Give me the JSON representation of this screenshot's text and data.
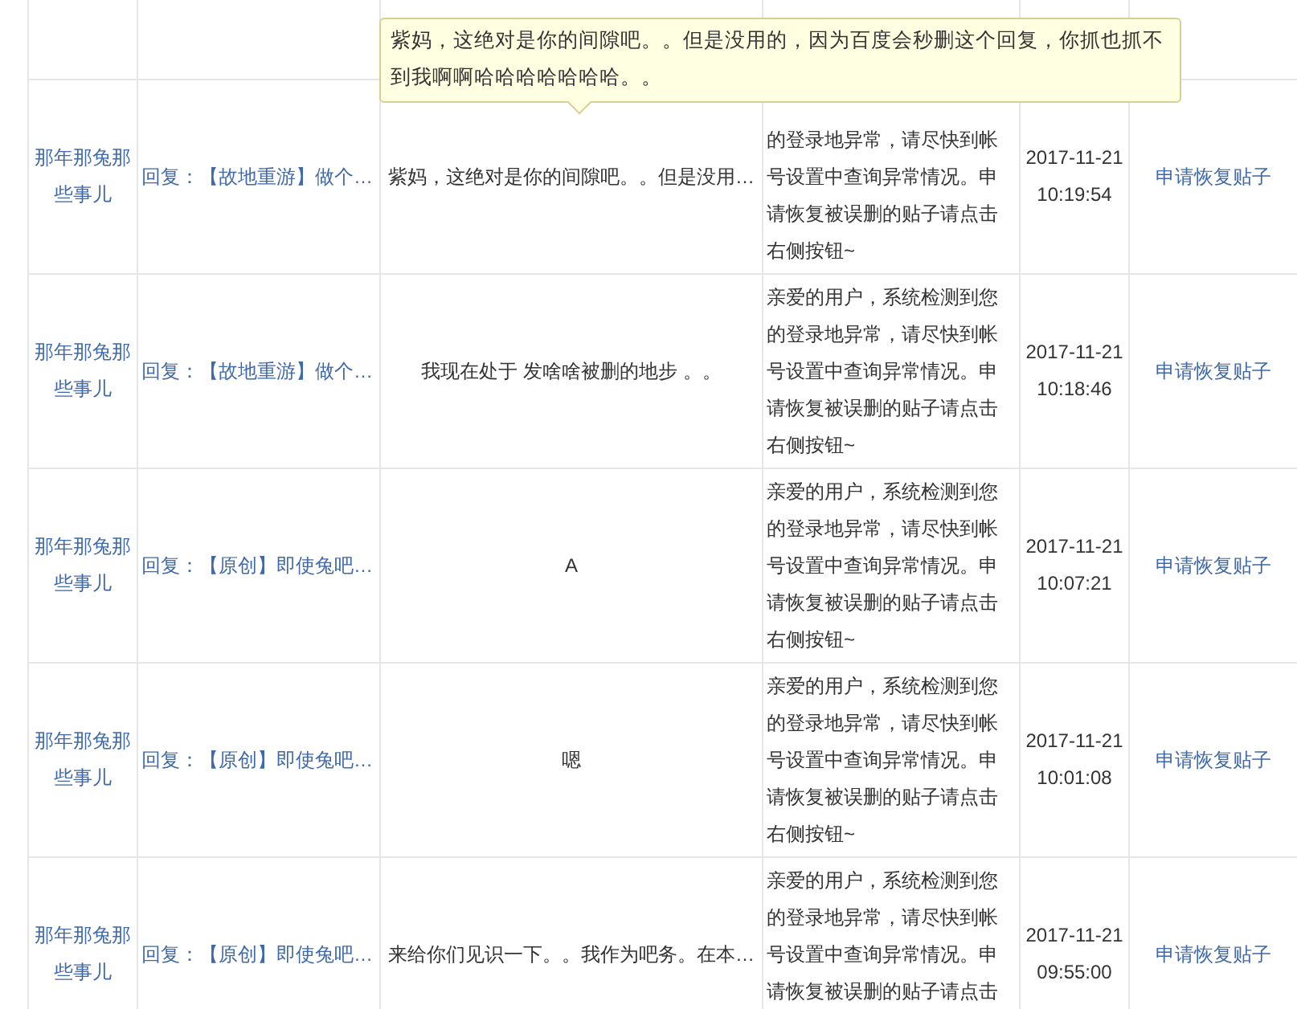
{
  "rows": [
    {
      "user": "那年那兔那些事儿",
      "title": "回复：【故地重游】做个…",
      "content": "紫妈，这绝对是你的间隙吧。。但是没用…",
      "reason": "的登录地异常，请尽快到帐号设置中查询异常情况。申请恢复被误删的贴子请点击右侧按钮~",
      "date": "2017-11-21",
      "time": "10:19:54",
      "action": "申请恢复贴子"
    },
    {
      "user": "那年那兔那些事儿",
      "title": "回复：【故地重游】做个…",
      "content": "我现在处于 发啥啥被删的地步 。。",
      "reason": "亲爱的用户，系统检测到您的登录地异常，请尽快到帐号设置中查询异常情况。申请恢复被误删的贴子请点击右侧按钮~",
      "date": "2017-11-21",
      "time": "10:18:46",
      "action": "申请恢复贴子"
    },
    {
      "user": "那年那兔那些事儿",
      "title": "回复：【原创】即使兔吧…",
      "content": "A",
      "reason": "亲爱的用户，系统检测到您的登录地异常，请尽快到帐号设置中查询异常情况。申请恢复被误删的贴子请点击右侧按钮~",
      "date": "2017-11-21",
      "time": "10:07:21",
      "action": "申请恢复贴子"
    },
    {
      "user": "那年那兔那些事儿",
      "title": "回复：【原创】即使兔吧…",
      "content": "嗯",
      "reason": "亲爱的用户，系统检测到您的登录地异常，请尽快到帐号设置中查询异常情况。申请恢复被误删的贴子请点击右侧按钮~",
      "date": "2017-11-21",
      "time": "10:01:08",
      "action": "申请恢复贴子"
    },
    {
      "user": "那年那兔那些事儿",
      "title": "回复：【原创】即使兔吧…",
      "content": "来给你们见识一下。。我作为吧务。在本…",
      "reason": "亲爱的用户，系统检测到您的登录地异常，请尽快到帐号设置中查询异常情况。申请恢复被误删的贴子请点击",
      "date": "2017-11-21",
      "time": "09:55:00",
      "action": "申请恢复贴子"
    }
  ],
  "tooltip": {
    "text": "紫妈，这绝对是你的间隙吧。。但是没用的，因为百度会秒删这个回复，你抓也抓不到我啊啊哈哈哈哈哈哈哈。。"
  }
}
